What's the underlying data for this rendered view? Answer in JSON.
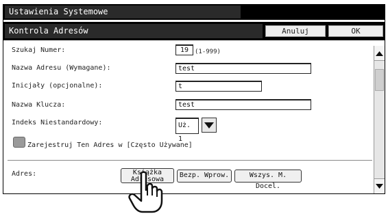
{
  "header": {
    "title": "Ustawienia Systemowe"
  },
  "subheader": {
    "title": "Kontrola Adresów",
    "cancel_label": "Anuluj",
    "ok_label": "OK"
  },
  "form": {
    "search_number": {
      "label": "Szukaj Numer:",
      "value": "19",
      "hint": "(1-999)"
    },
    "address_name": {
      "label": "Nazwa Adresu (Wymagane):",
      "value": "test"
    },
    "initials": {
      "label": "Inicjały (opcjonalne):",
      "value": "t"
    },
    "key_name": {
      "label": "Nazwa Klucza:",
      "value": "test"
    },
    "custom_index": {
      "label": "Indeks Niestandardowy:",
      "value": "Uż. 1"
    },
    "register_frequent": {
      "label": "Zarejestruj Ten Adres w [Często Używane]"
    },
    "address": {
      "label": "Adres:",
      "address_book_label": "Książka Adresowa",
      "direct_entry_label": "Bezp. Wprow.",
      "all_destinations_label": "Wszys. M. Docel."
    }
  }
}
